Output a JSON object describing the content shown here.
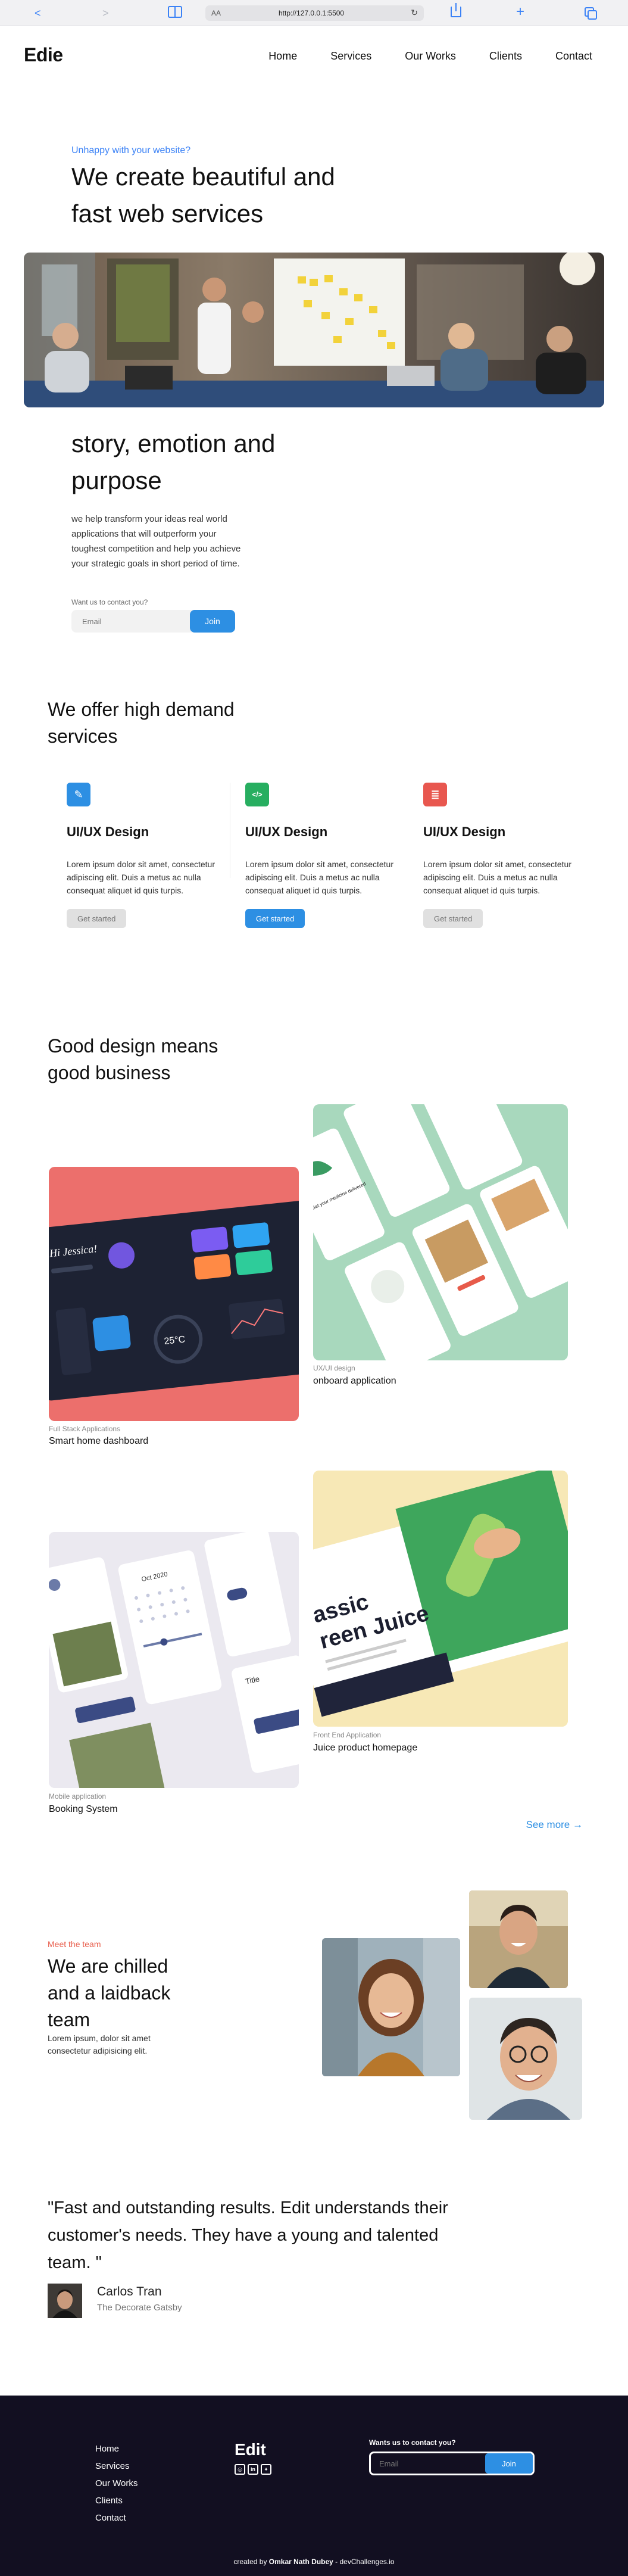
{
  "browser": {
    "text_size": "AA",
    "url": "http://127.0.0.1:5500",
    "back": "<",
    "forward": ">",
    "reload": "↻",
    "new_tab": "+"
  },
  "header": {
    "logo": "Edie",
    "nav": [
      "Home",
      "Services",
      "Our Works",
      "Clients",
      "Contact"
    ]
  },
  "hero": {
    "eyebrow": "Unhappy with your website?",
    "title": "We create beautiful and fast web services",
    "story_title": "story, emotion and purpose",
    "story_text": "we help transform your ideas real world applications that will outperform your toughest competition and help you achieve your strategic goals in short period of time.",
    "contact_label": "Want us to contact you?",
    "email_placeholder": "Email",
    "join_label": "Join"
  },
  "services": {
    "title": "We offer high demand services",
    "items": [
      {
        "title": "UI/UX Design",
        "text": "Lorem ipsum dolor sit amet, consectetur adipiscing elit. Duis a metus ac nulla consequat aliquet id quis turpis.",
        "button": "Get started",
        "icon": "pen-icon",
        "icon_glyph": "✎",
        "color": "#2d8fe3"
      },
      {
        "title": "UI/UX Design",
        "text": "Lorem ipsum dolor sit amet, consectetur adipiscing elit. Duis a metus ac nulla consequat aliquet id quis turpis.",
        "button": "Get started",
        "icon": "code-icon",
        "icon_glyph": "</>",
        "color": "#27ae60"
      },
      {
        "title": "UI/UX Design",
        "text": "Lorem ipsum dolor sit amet, consectetur adipiscing elit. Duis a metus ac nulla consequat aliquet id quis turpis.",
        "button": "Get started",
        "icon": "database-icon",
        "icon_glyph": "≣",
        "color": "#e8574f"
      }
    ]
  },
  "works": {
    "title": "Good design means good business",
    "items": [
      {
        "category": "Full Stack Applications",
        "name": "Smart home dashboard"
      },
      {
        "category": "UX/UI design",
        "name": "onboard application"
      },
      {
        "category": "Mobile application",
        "name": "Booking System"
      },
      {
        "category": "Front End Application",
        "name": "Juice product homepage"
      }
    ],
    "see_more": "See more →",
    "mock_texts": {
      "dashboard_greeting": "Hi Jessica!",
      "temperature": "25°C",
      "juice_line1": "assic",
      "juice_line2": "reen Juice",
      "calendar_month": "Oct 2020",
      "booking_heading": "Title",
      "onboard_heading": "Get your medicine delivered"
    }
  },
  "team": {
    "eyebrow": "Meet the team",
    "title": "We are chilled and a laidback team",
    "text": "Lorem ipsum, dolor sit amet consectetur adipisicing elit."
  },
  "testimonial": {
    "quote": "\"Fast and outstanding results. Edit understands their customer's needs. They have a young and talented team. \"",
    "name": "Carlos Tran",
    "role": "The Decorate Gatsby"
  },
  "footer": {
    "links": [
      "Home",
      "Services",
      "Our Works",
      "Clients",
      "Contact"
    ],
    "brand": "Edit",
    "social": [
      "instagram-icon",
      "linkedin-icon",
      "twitter-icon"
    ],
    "contact_label": "Wants us to contact you?",
    "email_placeholder": "Email",
    "join_label": "Join",
    "credit_prefix": "created by ",
    "credit_name": "Omkar Nath Dubey",
    "credit_suffix": " - devChallenges.io"
  }
}
